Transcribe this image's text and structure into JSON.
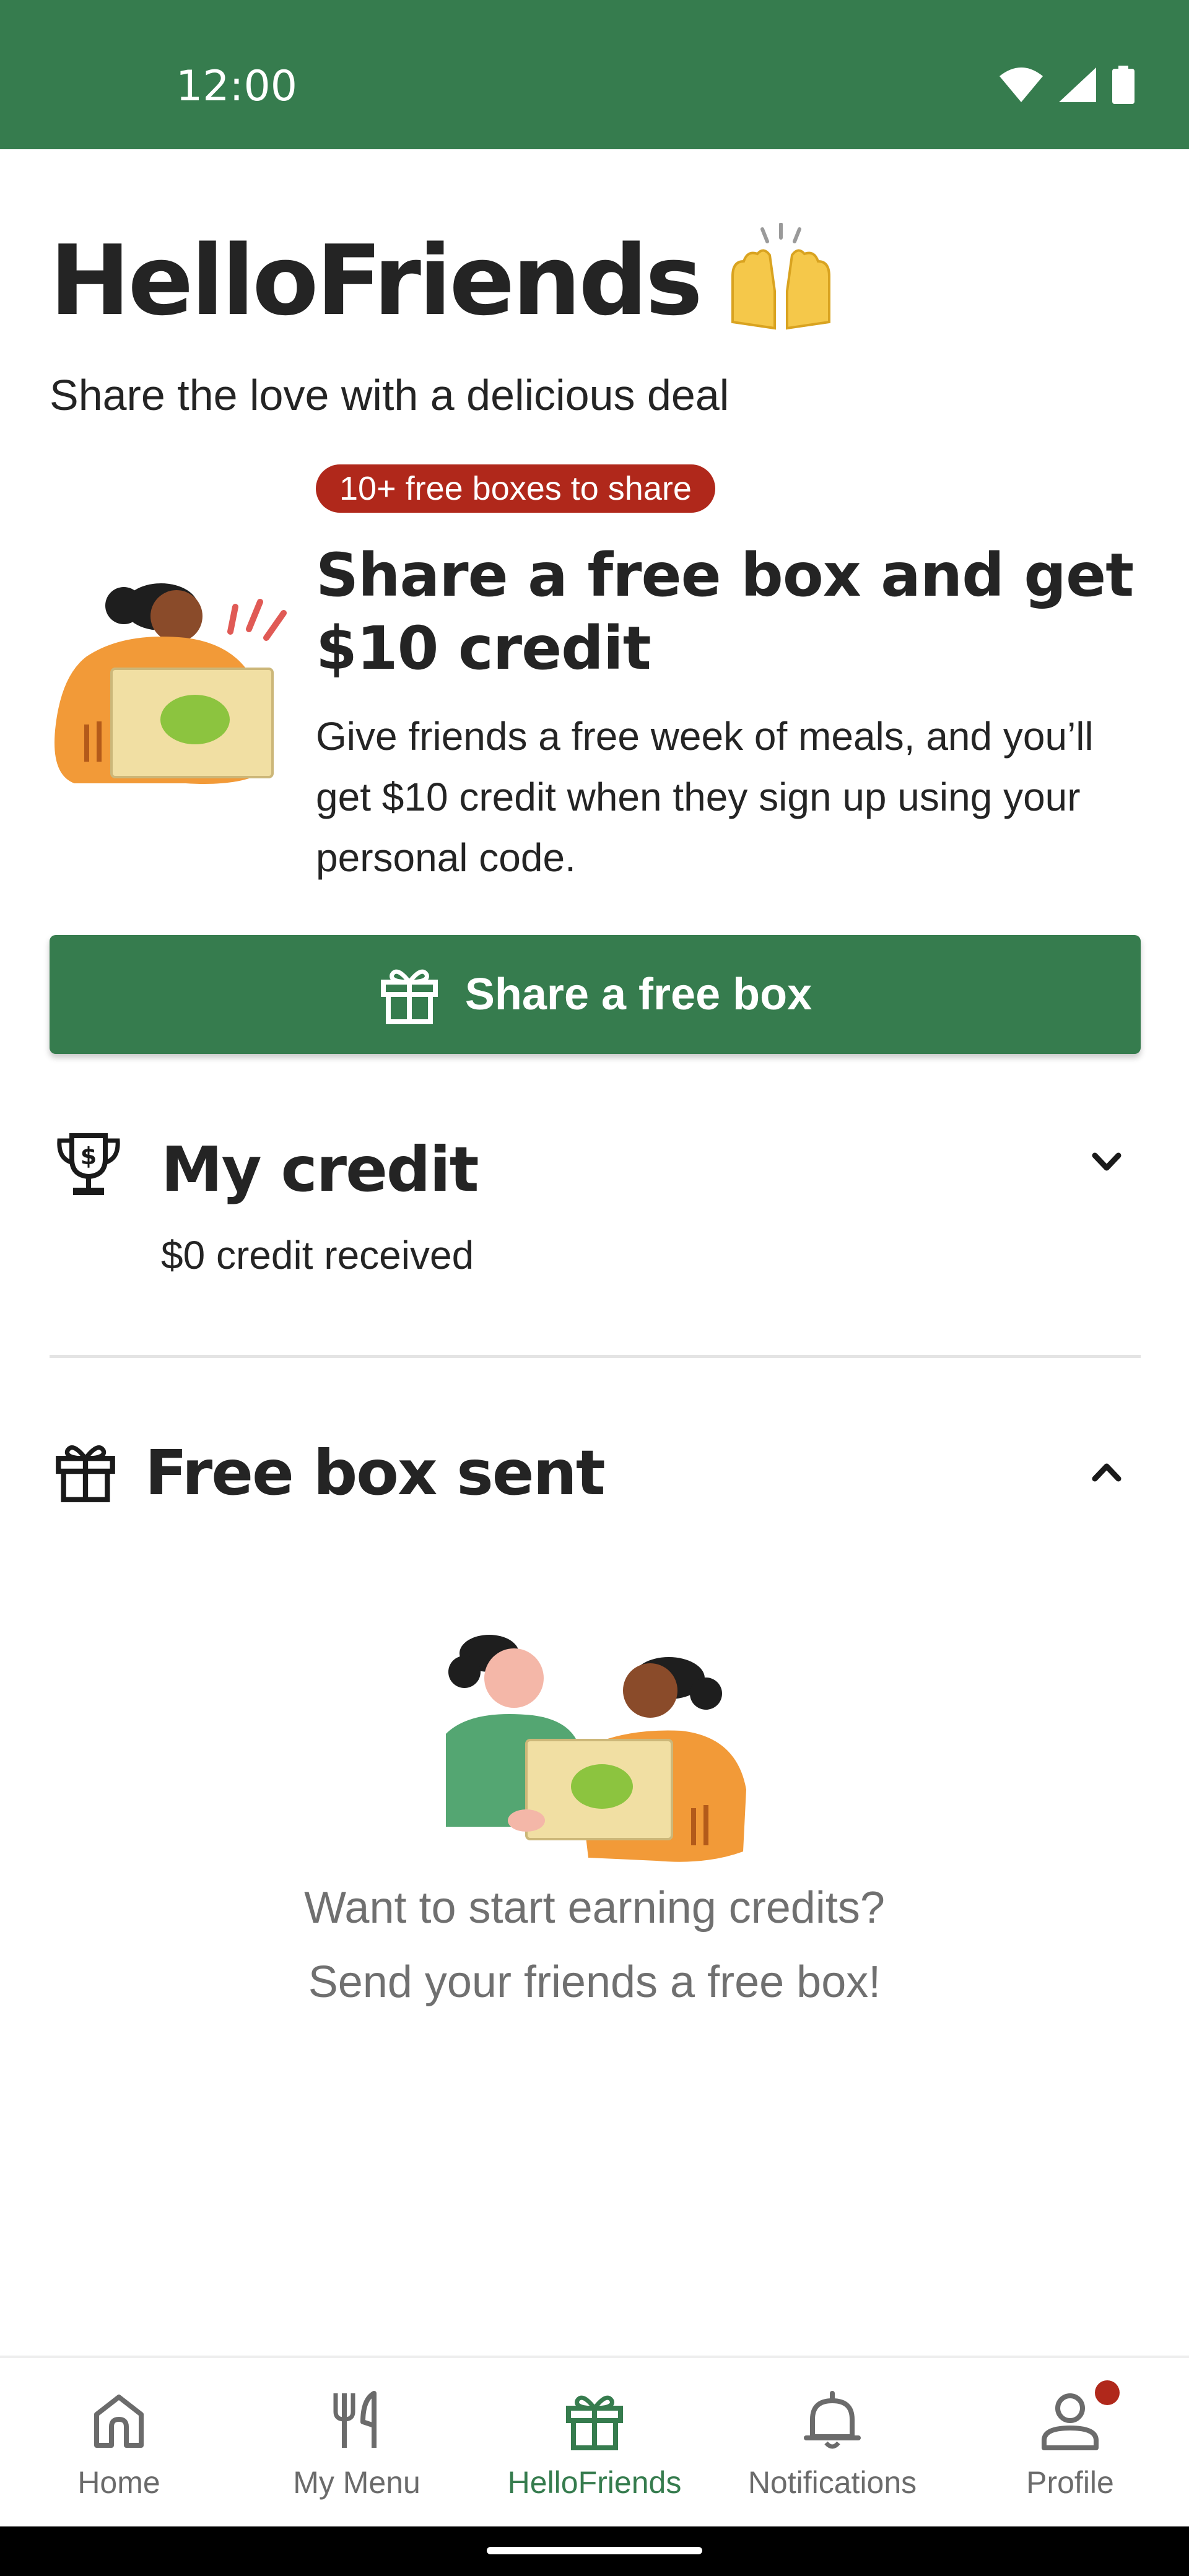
{
  "status_bar": {
    "time": "12:00",
    "icons": [
      "wifi-icon",
      "signal-icon",
      "battery-icon"
    ],
    "color": "#367c4e"
  },
  "header": {
    "title": "HelloFriends",
    "title_emoji": "raising-hands-emoji",
    "subtitle": "Share the love with a delicious deal"
  },
  "promo": {
    "badge": "10+ free boxes to share",
    "heading": "Share a free box and get $10 credit",
    "body": "Give friends a free week of meals, and you’ll get $10 credit when they sign up using your personal code.",
    "button_label": "Share a free box",
    "button_icon": "gift-icon"
  },
  "credit": {
    "title": "My credit",
    "subtitle": "$0 credit received",
    "icon": "trophy-icon",
    "expanded": false
  },
  "free_box_sent": {
    "title": "Free box sent",
    "icon": "gift-icon",
    "expanded": true,
    "empty_line1": "Want to start earning credits?",
    "empty_line2": "Send your friends a free box!"
  },
  "bottom_nav": {
    "items": [
      {
        "label": "Home",
        "icon": "home-icon",
        "active": false
      },
      {
        "label": "My Menu",
        "icon": "fork-knife-icon",
        "active": false
      },
      {
        "label": "HelloFriends",
        "icon": "gift-icon",
        "active": true
      },
      {
        "label": "Notifications",
        "icon": "bell-icon",
        "active": false
      },
      {
        "label": "Profile",
        "icon": "profile-icon",
        "active": false,
        "badge": true
      }
    ]
  },
  "colors": {
    "brand_green": "#367c4e",
    "badge_red": "#b0281b",
    "muted_text": "#707070"
  }
}
